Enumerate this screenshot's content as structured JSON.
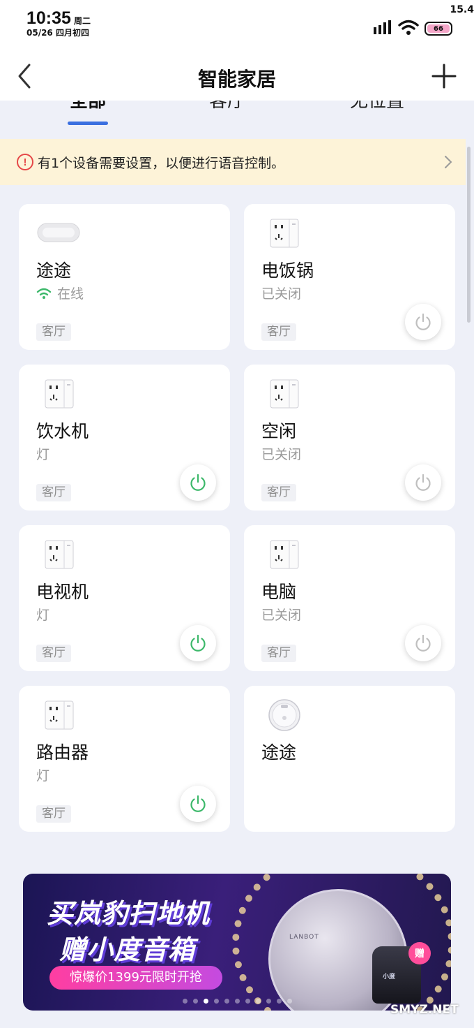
{
  "status_bar": {
    "time": "10:35",
    "weekday": "周二",
    "date": "05/26 四月初四",
    "speed": "15.4",
    "battery": "66"
  },
  "header": {
    "title": "智能家居"
  },
  "tabs": [
    {
      "label": "全部",
      "active": true
    },
    {
      "label": "客厅",
      "active": false
    },
    {
      "label": "无位置",
      "active": false
    }
  ],
  "notice": {
    "text": "有1个设备需要设置，以便进行语音控制。",
    "icon": "alert-circle-icon"
  },
  "devices": [
    {
      "name": "途途",
      "status": "在线",
      "room": "客厅",
      "icon": "smart-speaker-icon",
      "online": true,
      "power": "none"
    },
    {
      "name": "电饭锅",
      "status": "已关闭",
      "room": "客厅",
      "icon": "smart-plug-icon",
      "power": "off"
    },
    {
      "name": "饮水机",
      "status": "灯",
      "room": "客厅",
      "icon": "smart-plug-icon",
      "power": "on"
    },
    {
      "name": "空闲",
      "status": "已关闭",
      "room": "客厅",
      "icon": "smart-plug-icon",
      "power": "off"
    },
    {
      "name": "电视机",
      "status": "灯",
      "room": "客厅",
      "icon": "smart-plug-icon",
      "power": "on"
    },
    {
      "name": "电脑",
      "status": "已关闭",
      "room": "客厅",
      "icon": "smart-plug-icon",
      "power": "off"
    },
    {
      "name": "路由器",
      "status": "灯",
      "room": "客厅",
      "icon": "smart-plug-icon",
      "power": "on"
    },
    {
      "name": "途途",
      "status": "",
      "room": "",
      "icon": "robot-vacuum-icon",
      "power": "none"
    }
  ],
  "banner": {
    "line1": "买岚豹扫地机",
    "line2": "赠小度音箱",
    "price_text": "惊爆价1399元限时开抢",
    "gift_label": "赠",
    "robot_brand": "LANBOT",
    "speaker_brand": "小度",
    "page_count": 11,
    "active_page": 3
  },
  "watermark": "SMYZ.NET",
  "colors": {
    "accent": "#3a6fe0",
    "power_on": "#3cb86a",
    "power_off": "#bfbfbf",
    "warning": "#e54848",
    "notice_bg": "#fdf3d8"
  }
}
